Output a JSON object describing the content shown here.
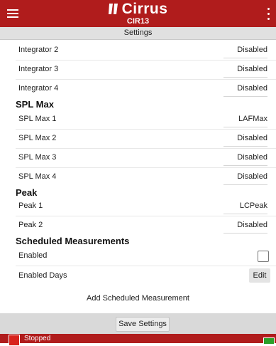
{
  "app": {
    "brand": "Cirrus",
    "model": "CIR13"
  },
  "subheader": {
    "title": "Settings"
  },
  "integrators": [
    {
      "label": "Integrator 2",
      "value": "Disabled"
    },
    {
      "label": "Integrator 3",
      "value": "Disabled"
    },
    {
      "label": "Integrator 4",
      "value": "Disabled"
    }
  ],
  "spl_max": {
    "heading": "SPL Max",
    "items": [
      {
        "label": "SPL Max 1",
        "value": "LAFMax"
      },
      {
        "label": "SPL Max 2",
        "value": "Disabled"
      },
      {
        "label": "SPL Max 3",
        "value": "Disabled"
      },
      {
        "label": "SPL Max 4",
        "value": "Disabled"
      }
    ]
  },
  "peak": {
    "heading": "Peak",
    "items": [
      {
        "label": "Peak 1",
        "value": "LCPeak"
      },
      {
        "label": "Peak 2",
        "value": "Disabled"
      }
    ]
  },
  "scheduled": {
    "heading": "Scheduled Measurements",
    "enabled_label": "Enabled",
    "enabled_checked": false,
    "days_label": "Enabled Days",
    "edit_label": "Edit",
    "add_label": "Add Scheduled Measurement"
  },
  "footer": {
    "save_label": "Save Settings"
  },
  "status": {
    "text": "Stopped"
  },
  "colors": {
    "brand_red": "#b01c1c",
    "status_red": "#d8221c",
    "status_green": "#2aa02a"
  },
  "icons": {
    "menu": "hamburger-menu-icon",
    "more": "kebab-menu-icon",
    "logo": "cirrus-logo-icon"
  }
}
